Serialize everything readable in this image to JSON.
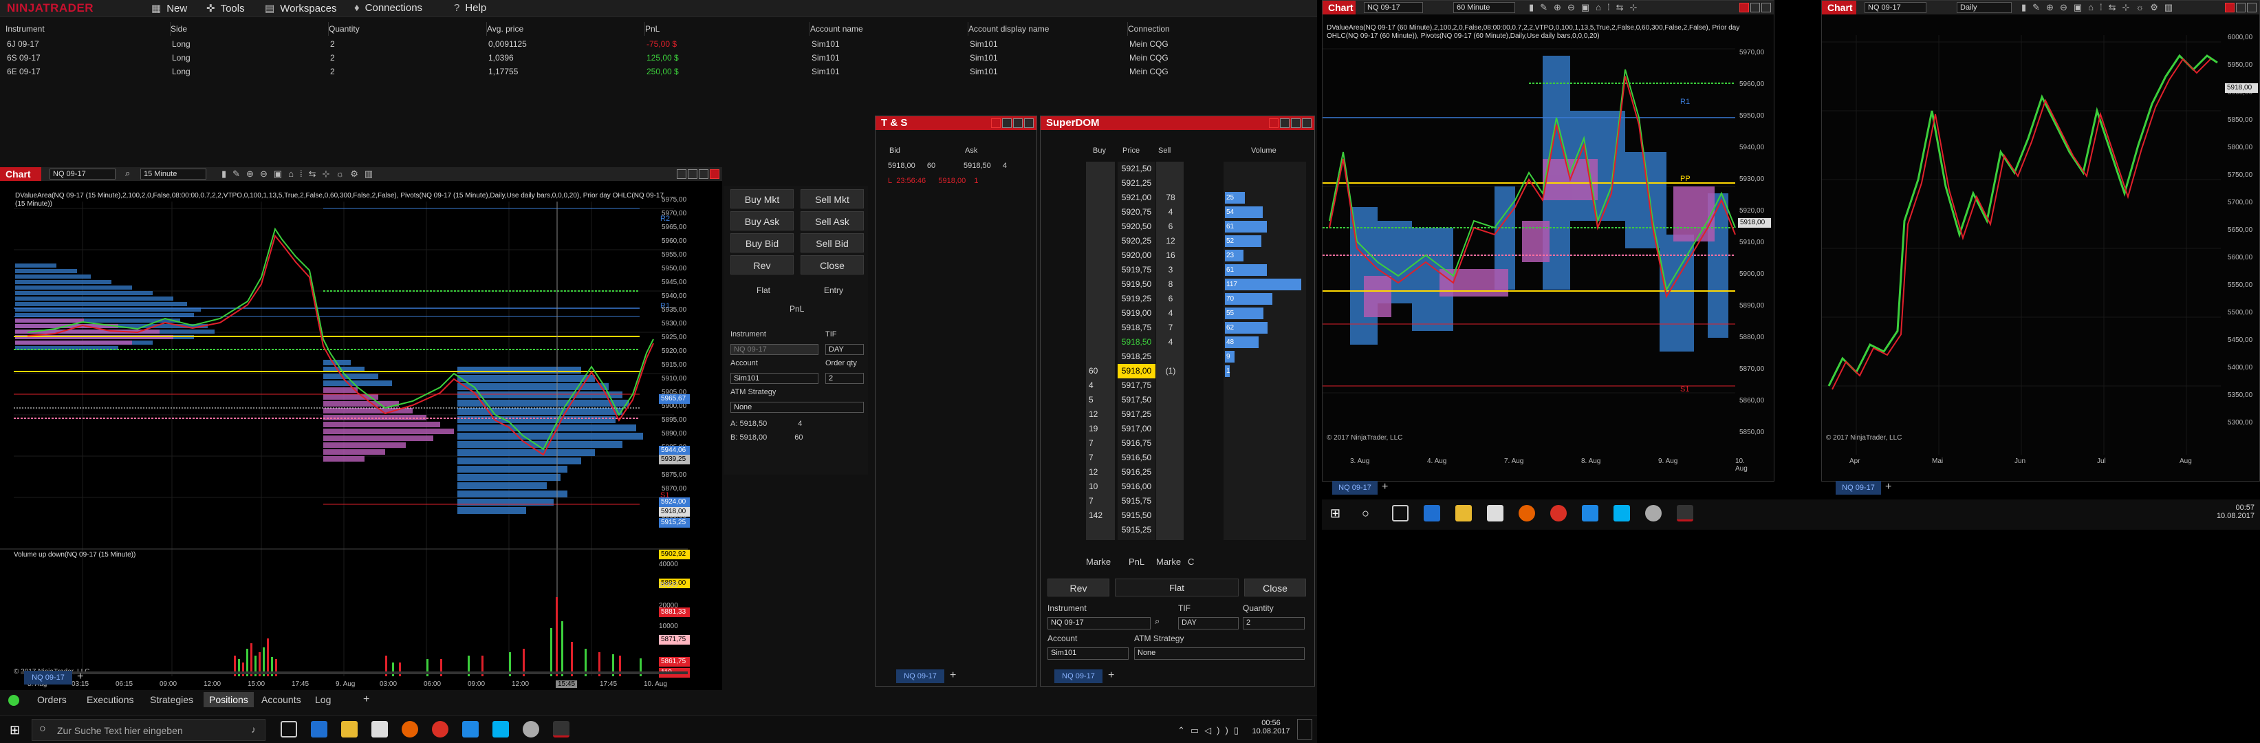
{
  "app": {
    "brand": "NINJATRADER"
  },
  "menu": {
    "new": "New",
    "tools": "Tools",
    "workspaces": "Workspaces",
    "connections": "Connections",
    "help": "Help"
  },
  "positions": {
    "headers": [
      "Instrument",
      "Side",
      "Quantity",
      "Avg. price",
      "PnL",
      "Account name",
      "Account display name",
      "Connection"
    ],
    "rows": [
      {
        "instrument": "6J 09-17",
        "side": "Long",
        "qty": "2",
        "avg": "0,0091125",
        "pnl": "-75,00 $",
        "pnl_color": "#e0202a",
        "acct": "Sim101",
        "disp": "Sim101",
        "conn": "Mein CQG"
      },
      {
        "instrument": "6S 09-17",
        "side": "Long",
        "qty": "2",
        "avg": "1,0396",
        "pnl": "125,00 $",
        "pnl_color": "#3ccf3c",
        "acct": "Sim101",
        "disp": "Sim101",
        "conn": "Mein CQG"
      },
      {
        "instrument": "6E 09-17",
        "side": "Long",
        "qty": "2",
        "avg": "1,17755",
        "pnl": "250,00 $",
        "pnl_color": "#3ccf3c",
        "acct": "Sim101",
        "disp": "Sim101",
        "conn": "Mein CQG"
      }
    ]
  },
  "chart1": {
    "title": "Chart",
    "instrument": "NQ 09-17",
    "interval": "15 Minute",
    "info": "DValueArea(NQ 09-17 (15 Minute),2,100,2,0,False,08:00:00,0.7,2,2,VTPO,0,100,1,13,5,True,2,False,0,60,300,False,2,False), Pivots(NQ 09-17 (15 Minute),Daily,Use daily bars,0,0,0,20), Prior day OHLC(NQ 09-17 (15 Minute))",
    "lower_title": "Volume up down(NQ 09-17 (15 Minute))",
    "copyright": "© 2017 NinjaTrader, LLC",
    "price_axis": [
      "5975,00",
      "5970,00",
      "5965,00",
      "5960,00",
      "5955,00",
      "5950,00",
      "5945,00",
      "5940,00",
      "5935,00",
      "5930,00",
      "5925,00",
      "5920,00",
      "5915,00",
      "5910,00",
      "5905,00",
      "5900,00",
      "5895,00",
      "5890,00",
      "5885,00",
      "5880,00",
      "5875,00",
      "5870,00",
      "5865,00",
      "5860,00"
    ],
    "tags": [
      {
        "text": "5965,67",
        "bg": "#3a7bd5"
      },
      {
        "text": "5944,06",
        "bg": "#3a7bd5"
      },
      {
        "text": "5939,25",
        "bg": "#bbbbbb"
      },
      {
        "text": "5924,00",
        "bg": "#3a7bd5"
      },
      {
        "text": "5918,00",
        "bg": "#dddddd"
      },
      {
        "text": "5915,25",
        "bg": "#3a7bd5"
      },
      {
        "text": "5902,92",
        "bg": "#ffd800"
      },
      {
        "text": "5893,00",
        "bg": "#ffd800"
      },
      {
        "text": "5881,33",
        "bg": "#e0202a"
      },
      {
        "text": "5871,75",
        "bg": "#ffb6c1"
      },
      {
        "text": "5861,75",
        "bg": "#e0202a"
      }
    ],
    "levels": {
      "r2": "R2",
      "r1": "R1",
      "pp": "PP",
      "s1": "S1"
    },
    "vol_axis": [
      "40000",
      "30000",
      "20000",
      "10000"
    ],
    "vol_tag": "119",
    "time_axis": [
      "8. Aug",
      "03:15",
      "06:15",
      "09:00",
      "12:00",
      "15:00",
      "17:45",
      "9. Aug",
      "03:00",
      "06:00",
      "09:00",
      "12:00",
      "15:45",
      "17:45",
      "10. Aug"
    ],
    "tab": "NQ 09-17"
  },
  "order_panel": {
    "buy_mkt": "Buy Mkt",
    "sell_mkt": "Sell Mkt",
    "buy_ask": "Buy Ask",
    "sell_ask": "Sell Ask",
    "buy_bid": "Buy Bid",
    "sell_bid": "Sell Bid",
    "rev": "Rev",
    "close": "Close",
    "flat": "Flat",
    "entry": "Entry",
    "pnl": "PnL",
    "instrument_lbl": "Instrument",
    "instrument": "NQ 09-17",
    "tif_lbl": "TIF",
    "tif": "DAY",
    "account_lbl": "Account",
    "account": "Sim101",
    "qty_lbl": "Order qty",
    "qty": "2",
    "atm_lbl": "ATM Strategy",
    "atm": "None",
    "a_lbl": "A:",
    "a_price": "5918,50",
    "a_qty": "4",
    "b_lbl": "B:",
    "b_price": "5918,00",
    "b_qty": "60"
  },
  "ts": {
    "title": "T & S",
    "bid_lbl": "Bid",
    "ask_lbl": "Ask",
    "bid": "5918,00",
    "bid_sz": "60",
    "ask": "5918,50",
    "ask_sz": "4",
    "row": {
      "flag": "L",
      "time": "23:56:46",
      "price": "5918,00",
      "size": "1"
    },
    "tab": "NQ 09-17"
  },
  "superdom": {
    "title": "SuperDOM",
    "h_buy": "Buy",
    "h_price": "Price",
    "h_sell": "Sell",
    "h_vol": "Volume",
    "rows": [
      {
        "buy": "",
        "price": "5921,50",
        "sell": "",
        "vol": ""
      },
      {
        "buy": "",
        "price": "5921,25",
        "sell": "",
        "vol": ""
      },
      {
        "buy": "",
        "price": "5921,00",
        "sell": "78",
        "vol": "25"
      },
      {
        "buy": "",
        "price": "5920,75",
        "sell": "4",
        "vol": "54"
      },
      {
        "buy": "",
        "price": "5920,50",
        "sell": "6",
        "vol": "61"
      },
      {
        "buy": "",
        "price": "5920,25",
        "sell": "12",
        "vol": "52"
      },
      {
        "buy": "",
        "price": "5920,00",
        "sell": "16",
        "vol": "23"
      },
      {
        "buy": "",
        "price": "5919,75",
        "sell": "3",
        "vol": "61"
      },
      {
        "buy": "",
        "price": "5919,50",
        "sell": "8",
        "vol": "117"
      },
      {
        "buy": "",
        "price": "5919,25",
        "sell": "6",
        "vol": "70"
      },
      {
        "buy": "",
        "price": "5919,00",
        "sell": "4",
        "vol": "55"
      },
      {
        "buy": "",
        "price": "5918,75",
        "sell": "7",
        "vol": "62"
      },
      {
        "buy": "",
        "price": "5918,50",
        "sell": "4",
        "vol": "48"
      },
      {
        "buy": "",
        "price": "5918,25",
        "sell": "",
        "vol": "9"
      },
      {
        "buy": "60",
        "price": "5918,00",
        "sell": "(1)",
        "vol": "1"
      },
      {
        "buy": "4",
        "price": "5917,75",
        "sell": "",
        "vol": ""
      },
      {
        "buy": "5",
        "price": "5917,50",
        "sell": "",
        "vol": ""
      },
      {
        "buy": "12",
        "price": "5917,25",
        "sell": "",
        "vol": ""
      },
      {
        "buy": "19",
        "price": "5917,00",
        "sell": "",
        "vol": ""
      },
      {
        "buy": "7",
        "price": "5916,75",
        "sell": "",
        "vol": ""
      },
      {
        "buy": "7",
        "price": "5916,50",
        "sell": "",
        "vol": ""
      },
      {
        "buy": "12",
        "price": "5916,25",
        "sell": "",
        "vol": ""
      },
      {
        "buy": "10",
        "price": "5916,00",
        "sell": "",
        "vol": ""
      },
      {
        "buy": "7",
        "price": "5915,75",
        "sell": "",
        "vol": ""
      },
      {
        "buy": "142",
        "price": "5915,50",
        "sell": "",
        "vol": ""
      },
      {
        "buy": "",
        "price": "5915,25",
        "sell": "",
        "vol": ""
      }
    ],
    "marke_l": "Marke",
    "pnl": "PnL",
    "marke_r": "Marke",
    "c": "C",
    "rev": "Rev",
    "flat": "Flat",
    "close": "Close",
    "instrument_lbl": "Instrument",
    "instrument": "NQ 09-17",
    "tif_lbl": "TIF",
    "tif": "DAY",
    "qty_lbl": "Quantity",
    "qty": "2",
    "account_lbl": "Account",
    "account": "Sim101",
    "atm_lbl": "ATM Strategy",
    "atm": "None",
    "tab": "NQ 09-17"
  },
  "chart2": {
    "info": "DValueArea(NQ 09-17 (60 Minute),2,100,2,0,False,08:00:00,0.7,2,2,VTPO,0,100,1,13,5,True,2,False,0,60,300,False,2,False), Prior day OHLC(NQ 09-17 (60 Minute)), Pivots(NQ 09-17 (60 Minute),Daily,Use daily bars,0,0,0,20)",
    "instrument": "NQ 09-17",
    "interval": "60 Minute",
    "price_axis": [
      "5970,00",
      "5960,00",
      "5950,00",
      "5940,00",
      "5930,00",
      "5920,00",
      "5910,00",
      "5900,00",
      "5890,00",
      "5880,00",
      "5870,00",
      "5860,00",
      "5850,00"
    ],
    "tag": "5918,00",
    "levels": {
      "r1": "R1",
      "pp": "PP",
      "s1": "S1"
    },
    "time_axis": [
      "3. Aug",
      "4. Aug",
      "7. Aug",
      "8. Aug",
      "9. Aug",
      "10. Aug"
    ],
    "copyright": "© 2017 NinjaTrader, LLC",
    "tab": "NQ 09-17"
  },
  "chart3": {
    "title": "Chart",
    "instrument": "NQ 09-17",
    "interval": "Daily",
    "price_axis": [
      "6000,00",
      "5950,00",
      "5900,00",
      "5850,00",
      "5800,00",
      "5750,00",
      "5700,00",
      "5650,00",
      "5600,00",
      "5550,00",
      "5500,00",
      "5450,00",
      "5400,00",
      "5350,00",
      "5300,00"
    ],
    "tag": "5918,00",
    "time_axis": [
      "Apr",
      "Mai",
      "Jun",
      "Jul",
      "Aug"
    ],
    "copyright": "© 2017 NinjaTrader, LLC",
    "tab": "NQ 09-17"
  },
  "bottom_tabs": {
    "orders": "Orders",
    "executions": "Executions",
    "strategies": "Strategies",
    "positions": "Positions",
    "accounts": "Accounts",
    "log": "Log"
  },
  "taskbar": {
    "search": "Zur Suche Text hier eingeben",
    "time": "00:56",
    "date": "10.08.2017",
    "time2": "00:57",
    "date2": "10.08.2017"
  },
  "colors": {
    "accent": "#c0141c",
    "blue": "#3a7bd5",
    "magenta": "#b05ab0",
    "green": "#3ccf3c",
    "yellow": "#ffd800"
  }
}
